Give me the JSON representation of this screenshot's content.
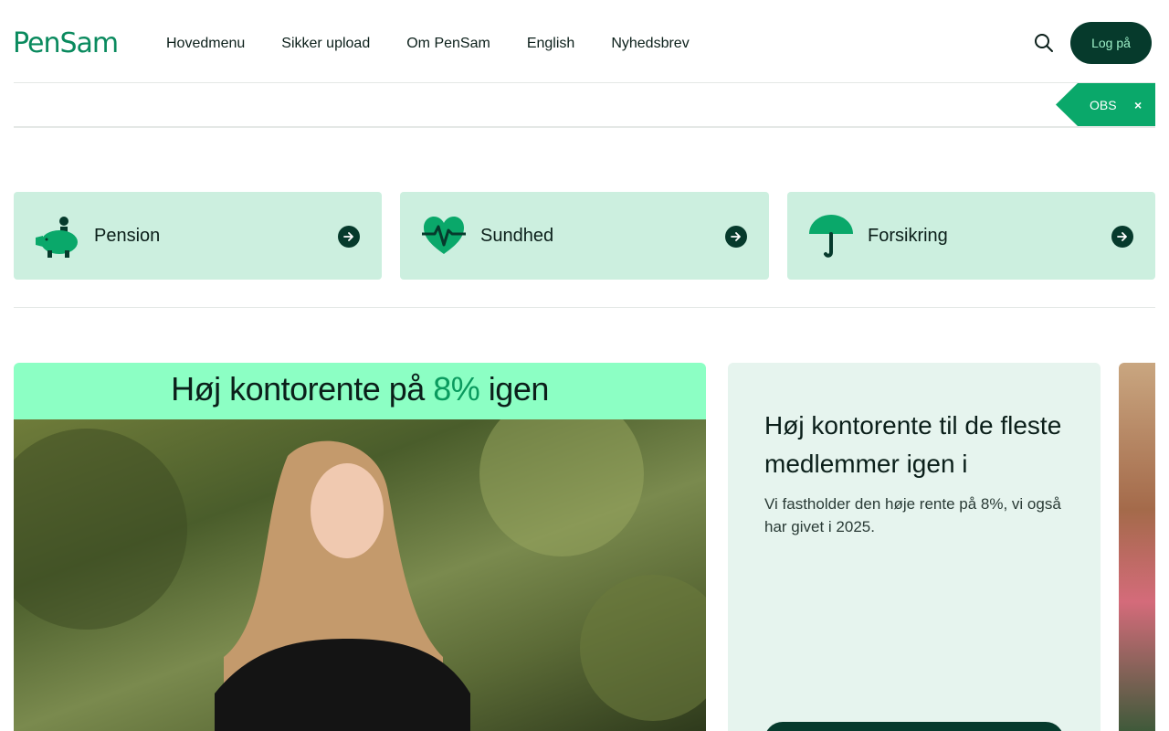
{
  "header": {
    "logo": "PenSam",
    "nav": [
      "Hovedmenu",
      "Sikker upload",
      "Om PenSam",
      "English",
      "Nyhedsbrev"
    ],
    "search_icon": "search-icon",
    "login_label": "Log på"
  },
  "notice": {
    "label": "OBS",
    "close": "×"
  },
  "categories": [
    {
      "label": "Pension",
      "icon": "piggy-bank-icon"
    },
    {
      "label": "Sundhed",
      "icon": "heartbeat-icon"
    },
    {
      "label": "Forsikring",
      "icon": "umbrella-icon"
    }
  ],
  "hero": {
    "banner_prefix": "Høj kontorente på ",
    "banner_accent": "8%",
    "banner_suffix": " igen"
  },
  "feature": {
    "title": "Høj kontorente til de fleste medlemmer igen i",
    "body": "Vi fastholder den høje rente på 8%, vi også har givet i 2025."
  },
  "colors": {
    "brand_green": "#0a8a5e",
    "dark_green": "#063a2c",
    "mint_card": "#ccefdf",
    "light_card": "#e6f4ee",
    "banner_mint": "#8cffc4",
    "obs_green": "#0aa86a"
  }
}
